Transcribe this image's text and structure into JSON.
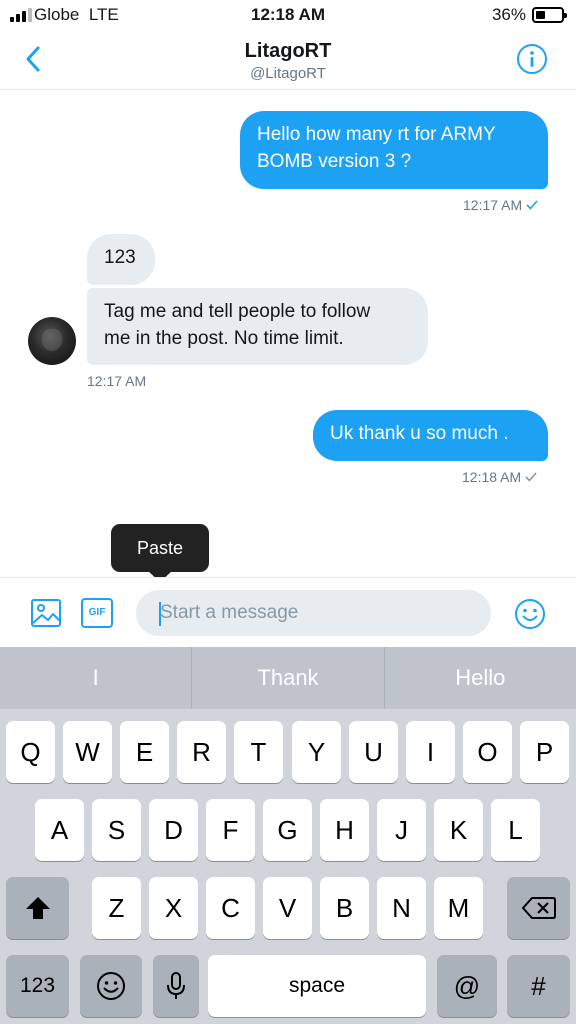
{
  "status_bar": {
    "carrier": "Globe",
    "network": "LTE",
    "time": "12:18 AM",
    "battery": "36%",
    "battery_level": 0.36
  },
  "header": {
    "name": "LitagoRT",
    "handle": "@LitagoRT"
  },
  "messages": [
    {
      "direction": "outgoing",
      "lines": [
        "Hello how many rt for ARMY",
        "BOMB version 3 ?"
      ]
    },
    {
      "direction": "incoming",
      "text": "123"
    },
    {
      "direction": "incoming",
      "lines": [
        "Tag me and tell people to follow",
        "me in the post. No time limit."
      ]
    },
    {
      "direction": "outgoing",
      "text": "Uk thank u so much ."
    }
  ],
  "timestamps": {
    "first": "12:17 AM",
    "second": "12:17 AM",
    "third": "12:18 AM"
  },
  "paste_label": "Paste",
  "composer": {
    "placeholder": "Start a message",
    "gif_label": "GIF"
  },
  "keyboard": {
    "suggestions": [
      "I",
      "Thank",
      "Hello"
    ],
    "row1": [
      "Q",
      "W",
      "E",
      "R",
      "T",
      "Y",
      "U",
      "I",
      "O",
      "P"
    ],
    "row2": [
      "A",
      "S",
      "D",
      "F",
      "G",
      "H",
      "J",
      "K",
      "L"
    ],
    "row3": [
      "Z",
      "X",
      "C",
      "V",
      "B",
      "N",
      "M"
    ],
    "numbers_label": "123",
    "space_label": "space",
    "at_label": "@",
    "hash_label": "#"
  },
  "colors": {
    "accent": "#1da1f2",
    "incoming_bubble": "#e6ecf0",
    "keyboard_bg": "#d1d4db"
  }
}
